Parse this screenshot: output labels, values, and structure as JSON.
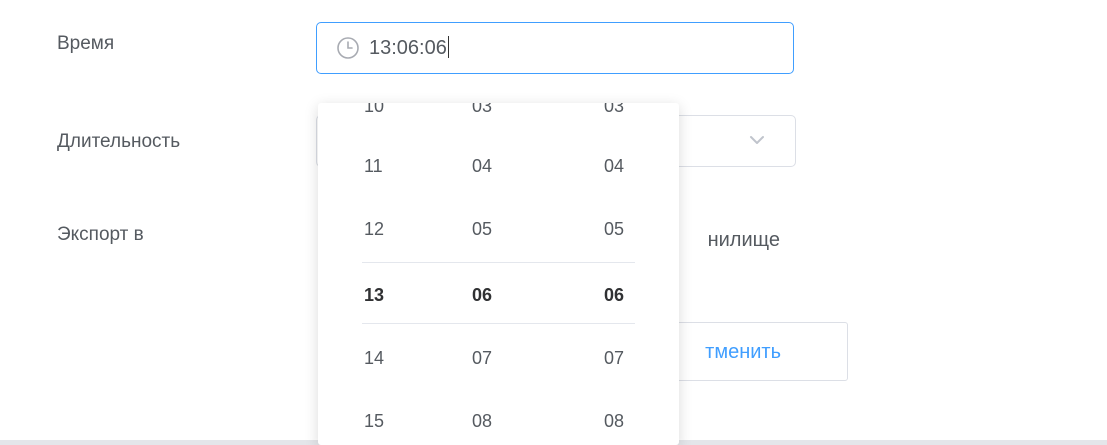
{
  "form": {
    "time_label": "Время",
    "duration_label": "Длительность",
    "export_label": "Экспорт в",
    "time_value": "13:06:06",
    "storage_fragment": "нилище",
    "cancel_fragment": "тменить"
  },
  "picker": {
    "hours": [
      "10",
      "11",
      "12",
      "13",
      "14",
      "15"
    ],
    "minutes": [
      "03",
      "04",
      "05",
      "06",
      "07",
      "08"
    ],
    "seconds": [
      "03",
      "04",
      "05",
      "06",
      "07",
      "08"
    ],
    "selected": {
      "hour": "13",
      "minute": "06",
      "second": "06"
    }
  },
  "colors": {
    "accent": "#409eff",
    "text": "#555a60",
    "border": "#dcdfe6"
  },
  "icons": {
    "time_input_icon": "clock-icon",
    "duration_dropdown_icon": "chevron-down-icon"
  }
}
